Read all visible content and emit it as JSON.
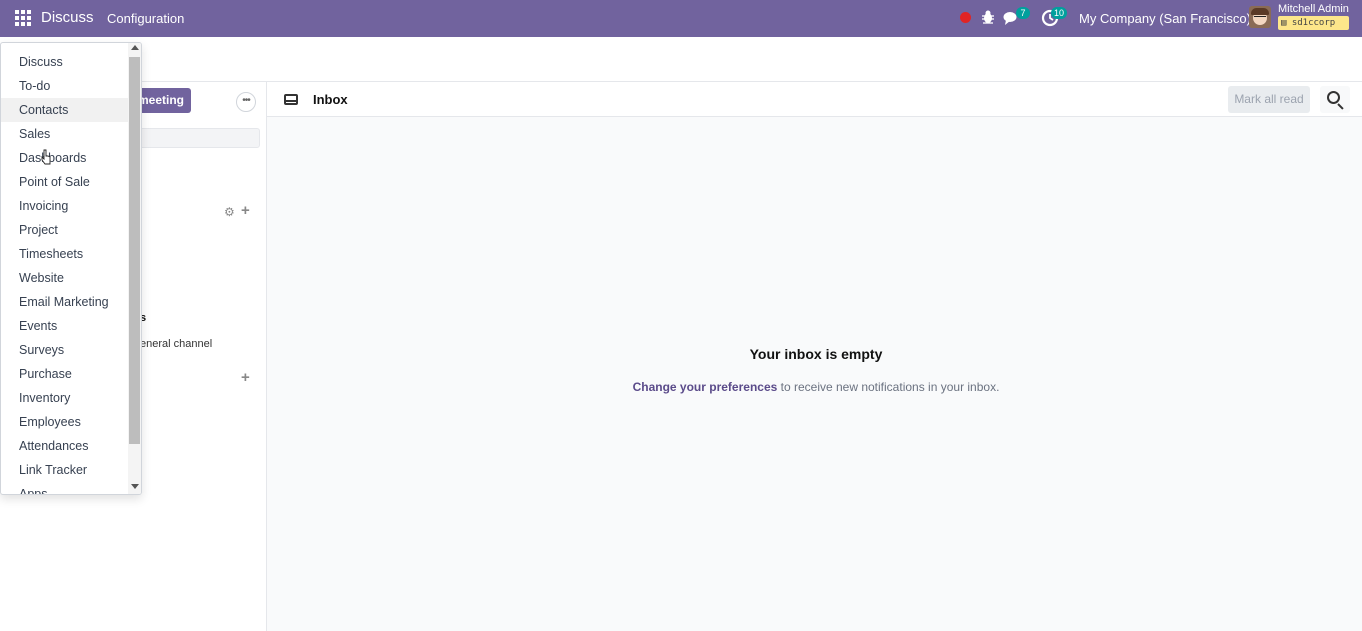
{
  "navbar": {
    "brand": "Discuss",
    "menu_config": "Configuration",
    "chat_count": "7",
    "activity_count": "10",
    "company": "My Company (San Francisco)",
    "user_name": "Mitchell Admin",
    "database": "sd1ccorp",
    "accent_color": "#71639e"
  },
  "sidebar": {
    "start_meeting_label": "meeting",
    "fragment_bold": "s",
    "fragment_channel": "eneral channel"
  },
  "main": {
    "title": "Inbox",
    "mark_all_read": "Mark all read",
    "empty_title": "Your inbox is empty",
    "empty_link": "Change your preferences",
    "empty_text": " to receive new notifications in your inbox."
  },
  "app_menu": {
    "items": [
      "Discuss",
      "To-do",
      "Contacts",
      "Sales",
      "Dashboards",
      "Point of Sale",
      "Invoicing",
      "Project",
      "Timesheets",
      "Website",
      "Email Marketing",
      "Events",
      "Surveys",
      "Purchase",
      "Inventory",
      "Employees",
      "Attendances",
      "Link Tracker",
      "Apps"
    ],
    "hovered_item": "Contacts"
  }
}
